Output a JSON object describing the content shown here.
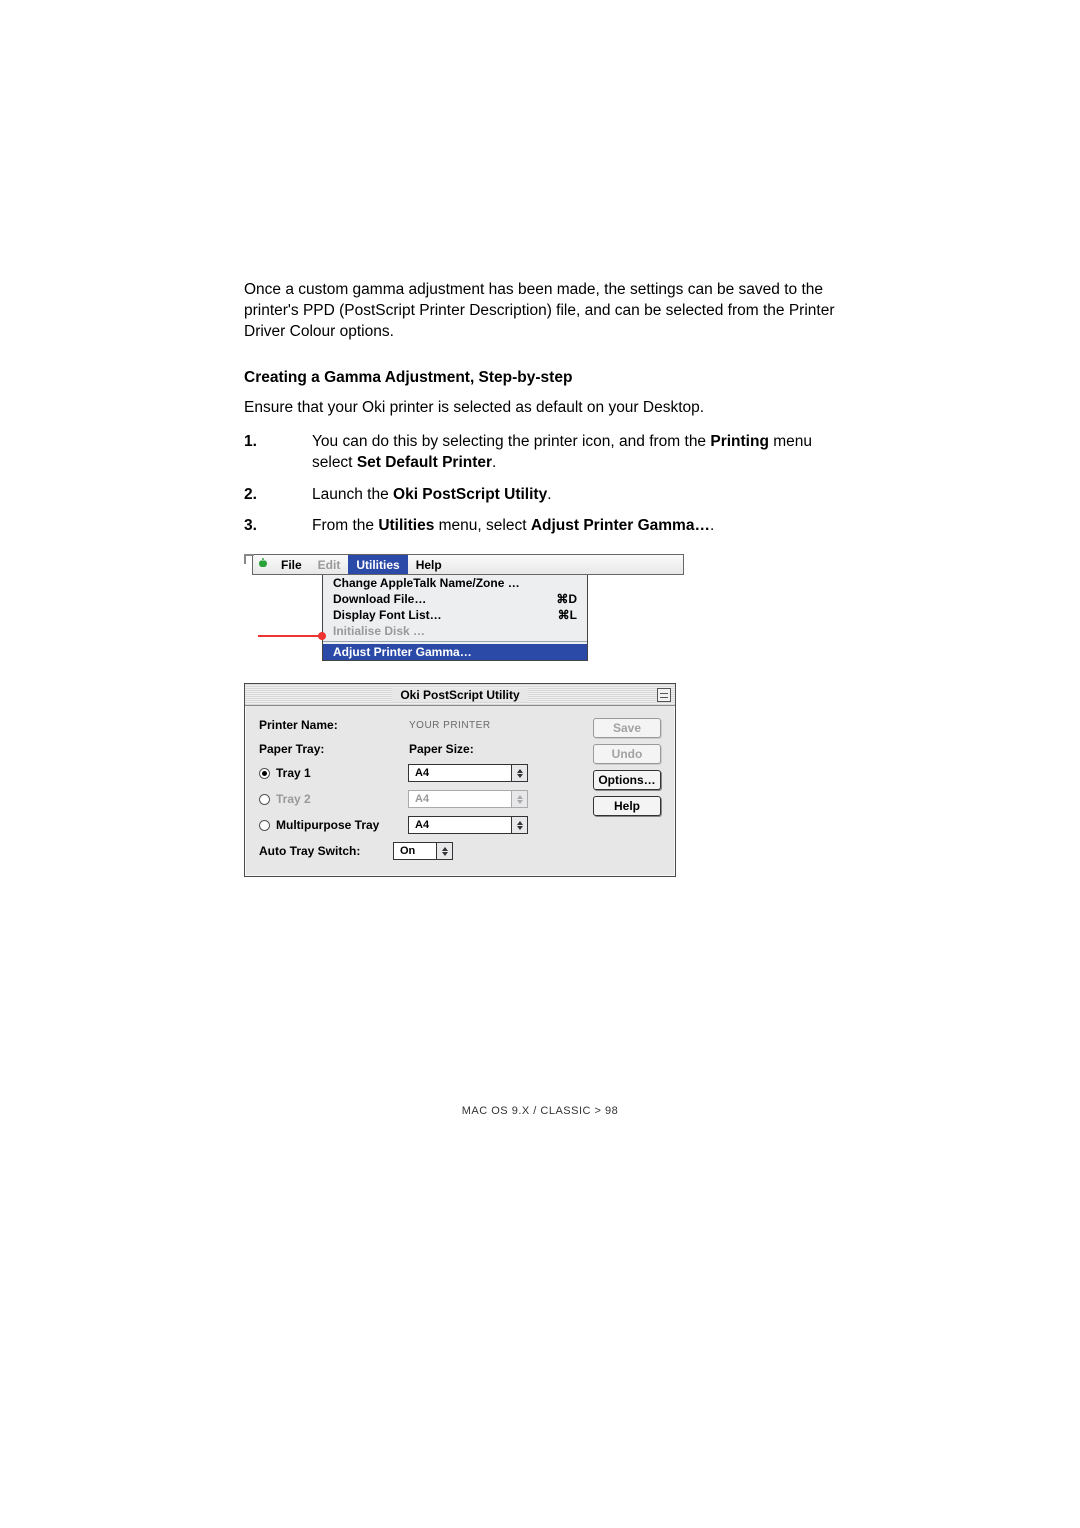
{
  "intro": "Once a custom gamma adjustment has been made, the settings can be saved to the printer's PPD (PostScript Printer Description) file, and can be selected from the Printer Driver Colour options.",
  "subheading": "Creating a Gamma Adjustment, Step-by-step",
  "ensure": "Ensure that your Oki printer is selected as default on your Desktop.",
  "steps": {
    "s1_num": "1.",
    "s1_a": "You can do this by selecting the printer icon, and from the ",
    "s1_b": "Printing",
    "s1_c": " menu select ",
    "s1_d": "Set Default Printer",
    "s1_e": ".",
    "s2_num": "2.",
    "s2_a": "Launch the ",
    "s2_b": "Oki PostScript Utility",
    "s2_c": ".",
    "s3_num": "3.",
    "s3_a": "From the ",
    "s3_b": "Utilities",
    "s3_c": " menu, select ",
    "s3_d": "Adjust Printer Gamma…",
    "s3_e": "."
  },
  "menubar": {
    "file": "File",
    "edit": "Edit",
    "utilities": "Utilities",
    "help": "Help"
  },
  "dropdown": {
    "change": "Change AppleTalk Name/Zone …",
    "download": "Download File…",
    "download_sc": "⌘D",
    "display": "Display Font List…",
    "display_sc": "⌘L",
    "init": "Initialise Disk …",
    "adjust": "Adjust Printer Gamma…"
  },
  "window": {
    "title": "Oki PostScript Utility",
    "printer_name_label": "Printer Name:",
    "printer_name_value": "YOUR PRINTER",
    "paper_tray_label": "Paper Tray:",
    "paper_size_label": "Paper Size:",
    "tray1": "Tray 1",
    "tray2": "Tray 2",
    "mptray": "Multipurpose Tray",
    "size1": "A4",
    "size2": "A4",
    "size3": "A4",
    "auto_switch_label": "Auto Tray Switch:",
    "auto_switch_value": "On",
    "btn_save": "Save",
    "btn_undo": "Undo",
    "btn_options": "Options…",
    "btn_help": "Help"
  },
  "footer": "MAC OS 9.X / CLASSIC > 98"
}
